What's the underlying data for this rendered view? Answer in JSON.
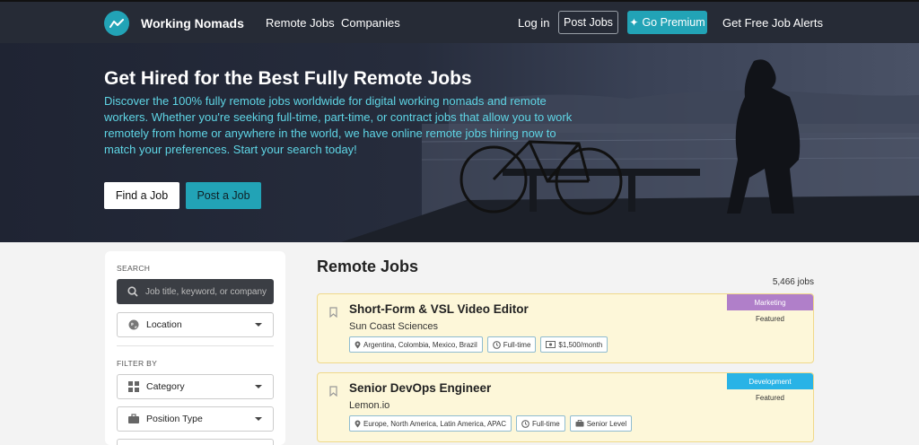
{
  "nav": {
    "brand": "Working Nomads",
    "links": [
      "Remote Jobs",
      "Companies"
    ],
    "login": "Log in",
    "post_jobs": "Post Jobs",
    "go_premium": "Go Premium",
    "premium_icon": "sparkle-icon",
    "job_alerts": "Get Free Job Alerts"
  },
  "hero": {
    "title": "Get Hired for the Best Fully Remote Jobs",
    "description": "Discover the 100% fully remote jobs worldwide for digital working nomads and remote workers. Whether you're seeking full-time, part-time, or contract jobs that allow you to work remotely from home or anywhere in the world, we have online remote jobs hiring now to match your preferences. Start your search today!",
    "find_job": "Find a Job",
    "post_job": "Post a Job"
  },
  "sidebar": {
    "search_label": "SEARCH",
    "search_placeholder": "Job title, keyword, or company",
    "location": "Location",
    "filter_label": "FILTER BY",
    "category": "Category",
    "position_type": "Position Type"
  },
  "main": {
    "title": "Remote Jobs",
    "job_count": "5,466 jobs",
    "jobs": [
      {
        "title": "Short-Form & VSL Video Editor",
        "company": "Sun Coast Sciences",
        "category": "Marketing",
        "category_color": "#b07fc9",
        "featured": "Featured",
        "location": "Argentina, Colombia, Mexico, Brazil",
        "type": "Full-time",
        "extra": "$1,500/month",
        "extra_icon": "money-icon"
      },
      {
        "title": "Senior DevOps Engineer",
        "company": "Lemon.io",
        "category": "Development",
        "category_color": "#29b3e6",
        "featured": "Featured",
        "location": "Europe, North America, Latin America, APAC",
        "type": "Full-time",
        "extra": "Senior Level",
        "extra_icon": "briefcase-icon"
      }
    ]
  },
  "colors": {
    "accent": "#22a3b6",
    "nav_bg": "#262b36",
    "card_bg": "#fdf7d9",
    "card_border": "#f0d98a"
  }
}
